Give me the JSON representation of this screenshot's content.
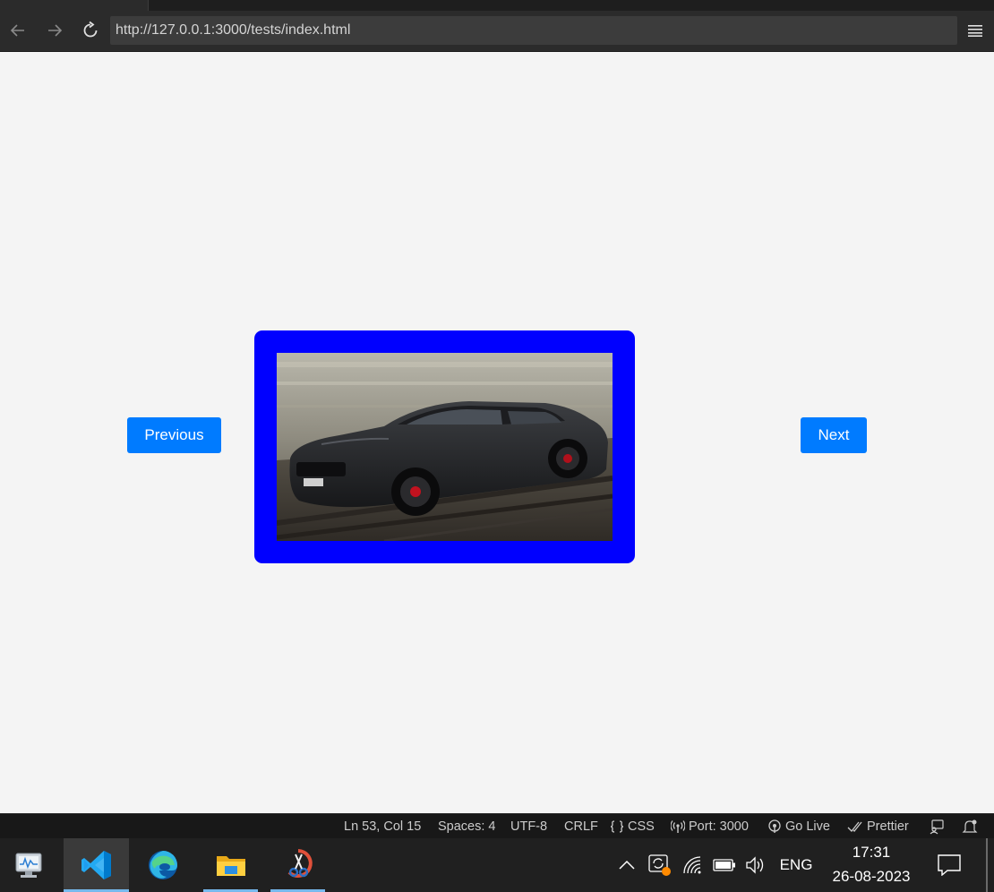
{
  "browser": {
    "url": "http://127.0.0.1:3000/tests/index.html"
  },
  "page": {
    "previous_label": "Previous",
    "next_label": "Next",
    "frame_color": "#0000ff",
    "button_color": "#007bff"
  },
  "statusbar": {
    "position": "Ln 53, Col 15",
    "spaces": "Spaces: 4",
    "encoding": "UTF-8",
    "eol": "CRLF",
    "language": "CSS",
    "port": "Port: 3000",
    "go_live": "Go Live",
    "prettier": "Prettier"
  },
  "taskbar": {
    "apps": [
      "performance-monitor",
      "visual-studio-code",
      "microsoft-edge",
      "file-explorer",
      "snipping-tool"
    ],
    "language": "ENG",
    "time": "17:31",
    "date": "26-08-2023"
  }
}
